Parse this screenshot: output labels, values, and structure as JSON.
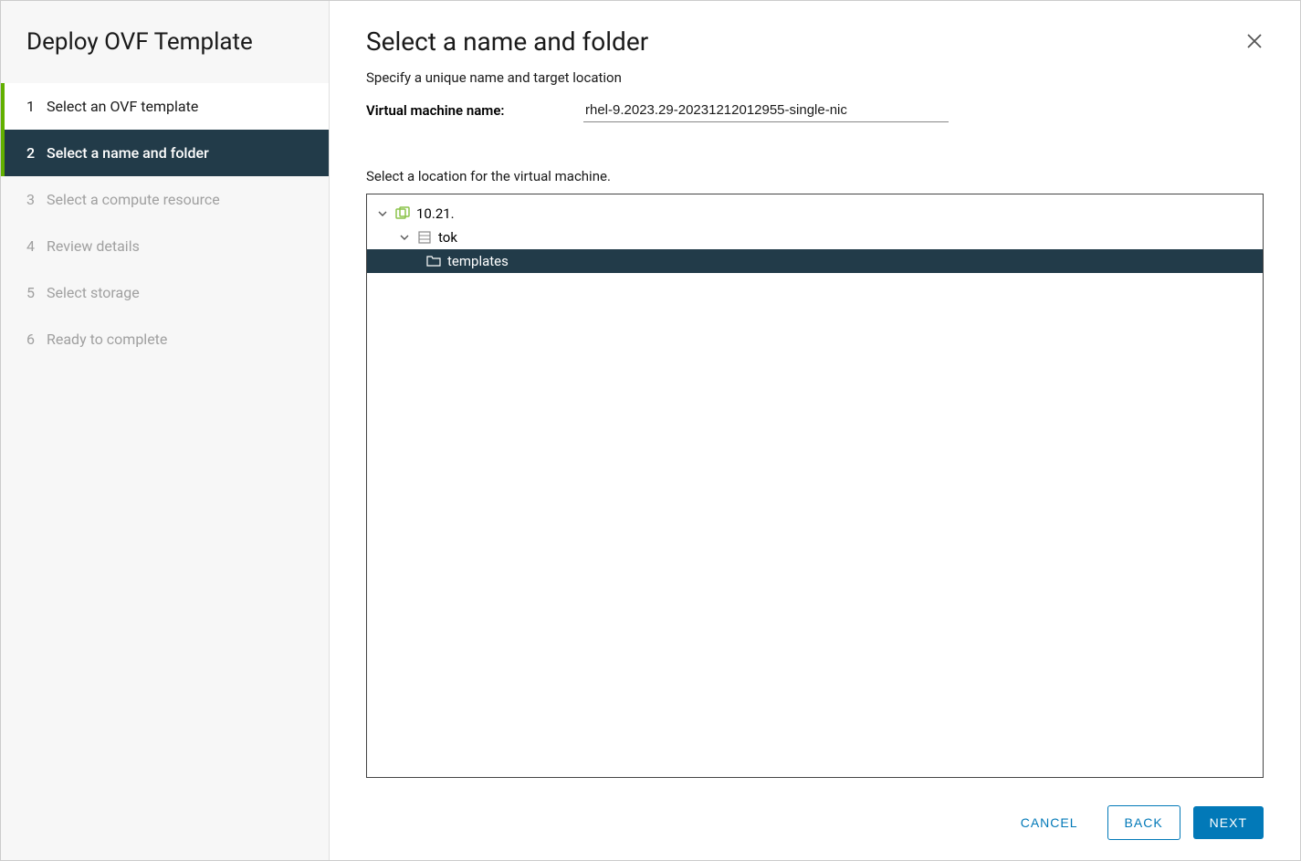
{
  "wizard_title": "Deploy OVF Template",
  "steps": [
    {
      "num": "1",
      "label": "Select an OVF template",
      "state": "completed"
    },
    {
      "num": "2",
      "label": "Select a name and folder",
      "state": "active"
    },
    {
      "num": "3",
      "label": "Select a compute resource",
      "state": "disabled"
    },
    {
      "num": "4",
      "label": "Review details",
      "state": "disabled"
    },
    {
      "num": "5",
      "label": "Select storage",
      "state": "disabled"
    },
    {
      "num": "6",
      "label": "Ready to complete",
      "state": "disabled"
    }
  ],
  "page": {
    "title": "Select a name and folder",
    "subtitle": "Specify a unique name and target location",
    "vm_name_label": "Virtual machine name:",
    "vm_name_value": "rhel-9.2023.29-20231212012955-single-nic",
    "location_label": "Select a location for the virtual machine."
  },
  "tree": {
    "root": {
      "label": "10.21."
    },
    "datacenter": {
      "label": "tok"
    },
    "folder": {
      "label": "templates"
    }
  },
  "footer": {
    "cancel": "CANCEL",
    "back": "BACK",
    "next": "NEXT"
  }
}
